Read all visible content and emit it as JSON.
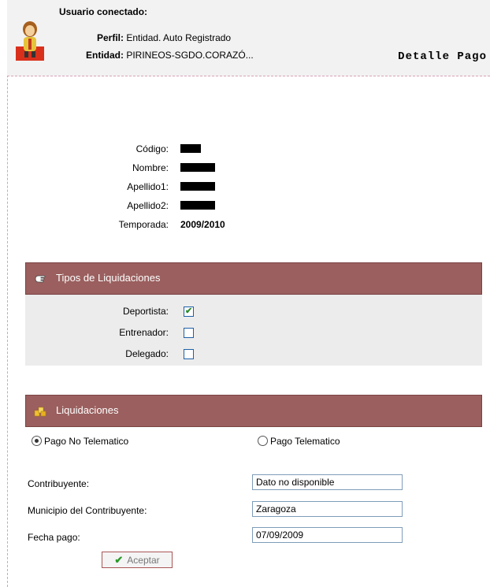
{
  "header": {
    "user_label": "Usuario conectado:",
    "perfil_label": "Perfil:",
    "perfil_value": "Entidad. Auto Registrado",
    "entidad_label": "Entidad:",
    "entidad_value": "PIRINEOS-SGDO.CORAZÓ...",
    "page_title": "Detalle Pago"
  },
  "person": {
    "codigo_label": "Código:",
    "nombre_label": "Nombre:",
    "apellido1_label": "Apellido1:",
    "apellido2_label": "Apellido2:",
    "temporada_label": "Temporada:",
    "temporada_value": "2009/2010"
  },
  "tipos": {
    "title": "Tipos de Liquidaciones",
    "items": [
      {
        "label": "Deportista:",
        "checked": true
      },
      {
        "label": "Entrenador:",
        "checked": false
      },
      {
        "label": "Delegado:",
        "checked": false
      }
    ]
  },
  "liquidaciones": {
    "title": "Liquidaciones",
    "radio_no_telematico": "Pago No Telematico",
    "radio_telematico": "Pago Telematico",
    "selected": "Pago No Telematico",
    "contribuyente_label": "Contribuyente:",
    "contribuyente_value": "Dato no disponible",
    "municipio_label": "Municipio del Contribuyente:",
    "municipio_value": "Zaragoza",
    "fecha_label": "Fecha pago:",
    "fecha_value": "07/09/2009",
    "submit_label": "Aceptar"
  },
  "colors": {
    "section_bar": "#9a5f5e",
    "panel_bg": "#ececec",
    "header_bg": "#f2f2f2",
    "check_green": "#2a8a2a"
  },
  "icons": {
    "logo": "user-avatar-icon",
    "tipos": "hand-pointer-icon",
    "liquidaciones": "folders-icon",
    "submit": "checkmark-icon"
  }
}
